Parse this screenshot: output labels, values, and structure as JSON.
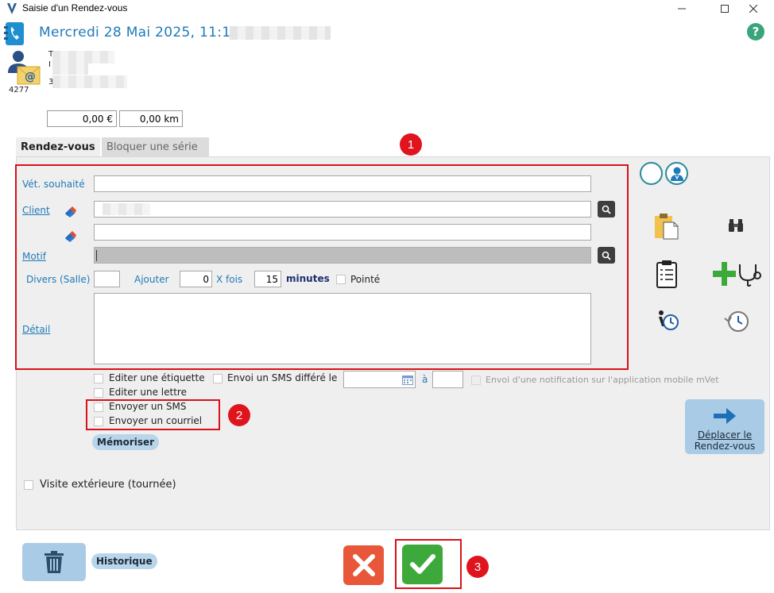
{
  "window": {
    "title": "Saisie d'un Rendez-vous"
  },
  "header": {
    "date_text": "Mercredi 28 Mai 2025, 11:1",
    "client_code": "4277",
    "line1_prefix": "T",
    "line2_prefix": "I",
    "line3_prefix": "3",
    "amount": "0,00 €",
    "distance": "0,00 km"
  },
  "tabs": [
    {
      "label": "Rendez-vous",
      "active": true
    },
    {
      "label": "Bloquer une série",
      "active": false
    }
  ],
  "form": {
    "vet_label": "Vét. souhaité",
    "vet_value": "",
    "client_label": "Client",
    "client_value": "",
    "client2_value": "",
    "motif_label": "Motif",
    "motif_value": "",
    "divers_label": "Divers (Salle)",
    "divers_value": "",
    "ajouter_label": "Ajouter",
    "ajouter_value": "0",
    "xfois_label": "X fois",
    "xfois_value": "15",
    "minutes_label": "minutes",
    "pointe_label": "Pointé",
    "detail_label": "Détail",
    "detail_value": ""
  },
  "options": {
    "etiquette_label": "Editer une étiquette",
    "lettre_label": "Editer une lettre",
    "sms_label": "Envoyer un SMS",
    "courriel_label": "Envoyer un courriel",
    "sms_differe_label": "Envoi un SMS différé le",
    "sms_differe_date": "",
    "a_label": "à",
    "sms_differe_time": "",
    "notif_label": "Envoi d'une notification sur l'application mobile mVet",
    "memoriser_label": "Mémoriser",
    "visite_label": "Visite extérieure (tournée)"
  },
  "actions": {
    "deplacer_label_1": "Déplacer le",
    "deplacer_label_2": "Rendez-vous",
    "historique_label": "Historique"
  },
  "annotations": [
    "1",
    "2",
    "3"
  ],
  "colors": {
    "accent_blue": "#1f7ab8",
    "highlight_red": "#d9111a",
    "cancel_red": "#e8573a",
    "confirm_green": "#3ea93b"
  }
}
